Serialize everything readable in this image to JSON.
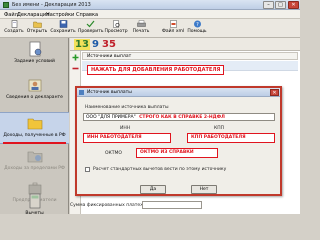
{
  "window": {
    "title": "Без имени - Декларация 2013"
  },
  "menu": [
    "Файл",
    "Декларация",
    "Настройки",
    "Справка"
  ],
  "toolbar": [
    {
      "label": "Создать",
      "icon": "new-doc-icon"
    },
    {
      "label": "Открыть",
      "icon": "open-folder-icon"
    },
    {
      "label": "Сохранить",
      "icon": "save-icon"
    },
    {
      "label": "Проверить",
      "icon": "check-icon"
    },
    {
      "label": "Просмотр",
      "icon": "preview-icon"
    },
    {
      "label": "Печать",
      "icon": "print-icon"
    },
    {
      "label": "Файл xml",
      "icon": "xml-file-icon"
    },
    {
      "label": "Помощь",
      "icon": "help-icon"
    }
  ],
  "sidebar": [
    {
      "label": "Задание условий",
      "icon": "settings-doc-icon"
    },
    {
      "label": "Сведения о декларанте",
      "icon": "person-icon"
    },
    {
      "label": "Доходы, полученные в РФ",
      "icon": "folder-icon",
      "active": true
    },
    {
      "label": "Доходы за пределами РФ",
      "icon": "globe-folder-icon"
    },
    {
      "label": "Предприниматели",
      "icon": "briefcase-icon"
    },
    {
      "label": "Вычеты",
      "icon": "calculator-icon"
    }
  ],
  "main": {
    "rates": [
      "13",
      "9",
      "35"
    ],
    "grid_header": "Источники выплат",
    "footer_label": "Сумма фиксированных платежей"
  },
  "annotations": {
    "add_employer": "НАЖАТЬ ДЛЯ ДОБАВЛЕНИЯ РАБОТОДАТЕЛЯ",
    "name_hint": "СТРОГО КАК В СПРАВКЕ 2-НДФЛ",
    "inn": "ИНН РАБОТОДАТЕЛЯ",
    "kpp": "КПП РАБОТОДАТЕЛЯ",
    "oktmo": "ОКТМО ИЗ СПРАВКИ"
  },
  "dialog": {
    "title": "Источник выплаты",
    "name_label": "Наименование источника выплаты",
    "name_value": "ООО \"ДЛЯ ПРИМЕРА\"",
    "inn_label": "ИНН",
    "kpp_label": "КПП",
    "oktmo_label": "ОКТМО",
    "checkbox_label": "Расчет стандартных вычетов вести по этому источнику",
    "yes_button": "Да",
    "no_button": "Нет"
  },
  "colors": {
    "annotation": "#e0141e",
    "rate13": "#2d7a2d",
    "rate9": "#1c5aa8",
    "rate35": "#c0202a"
  }
}
